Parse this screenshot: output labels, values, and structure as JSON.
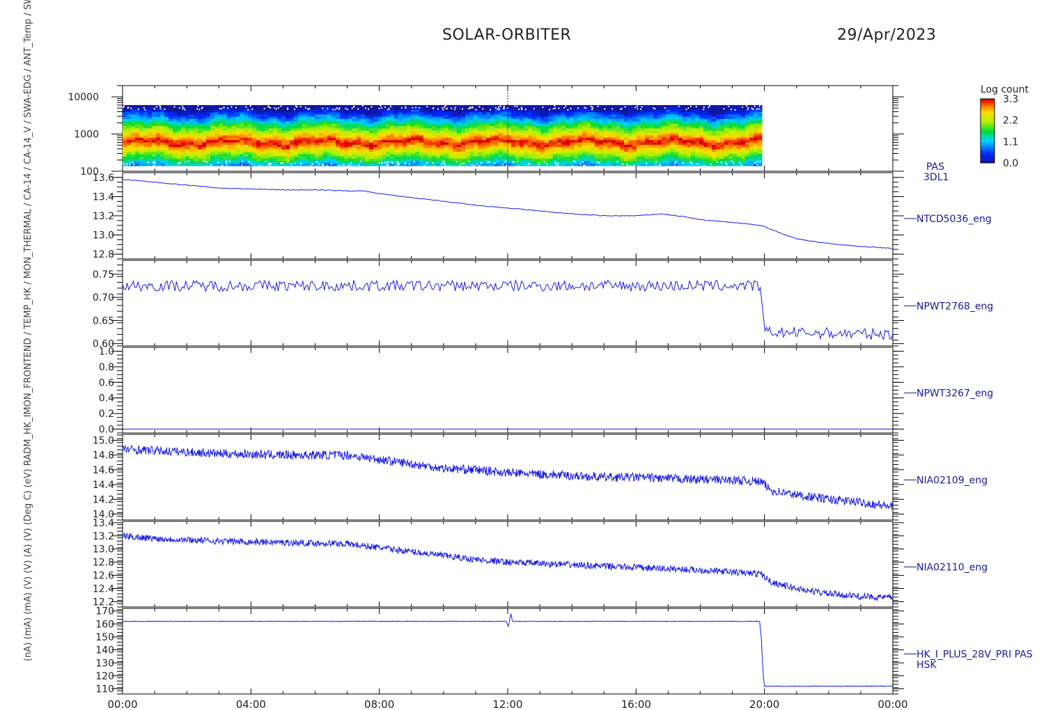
{
  "header": {
    "title": "SOLAR-ORBITER",
    "date": "29/Apr/2023"
  },
  "colors": {
    "trace": "#1a1ae6",
    "label": "#1a1a9a",
    "frame": "#000000"
  },
  "y_axis_stack_label": "(nA) (mA) (mA) (V) (V) (A) (V) (Deg C) (eV) RADM_HK_IMON_FRONTEND / TEMP_HK / MON_THERMAL / CA-14 / CA-14_V / SWA-EDG / ANT_Temp / SWA_EAS_Temp / Flux Temp (DegC) / E",
  "x_axis": {
    "ticks": [
      "00:00",
      "04:00",
      "08:00",
      "12:00",
      "16:00",
      "20:00",
      "00:00"
    ],
    "range_hours": [
      0,
      24
    ]
  },
  "colorbar": {
    "title": "Log count",
    "ticks": [
      "3.3",
      "2.2",
      "1.1",
      "0.0"
    ],
    "range": [
      0.0,
      3.3
    ]
  },
  "chart_data": [
    {
      "type": "heatmap",
      "panel": "PAS 3DL1",
      "right_label_1": "PAS",
      "right_label_2": "3DL1",
      "yscale": "log",
      "ylim": [
        100,
        20000
      ],
      "yticks": [
        "10000",
        "1000",
        "100"
      ],
      "data_end_hour": 19.85,
      "band_peak_energy_eV": 600,
      "band_low_eV": 140,
      "band_high_eV": 6000,
      "disturbance_hours": [
        10.8,
        12.0
      ]
    },
    {
      "type": "line",
      "name": "NTCD5036_eng",
      "ylim": [
        12.75,
        13.65
      ],
      "yticks": [
        "13.6",
        "13.4",
        "13.2",
        "13.0",
        "12.8"
      ],
      "x": [
        0,
        1,
        2,
        3,
        4,
        5,
        6,
        7,
        7.5,
        8,
        9,
        10,
        11,
        12,
        13,
        14,
        15,
        16,
        16.8,
        17.5,
        18,
        19,
        19.9,
        20.5,
        21,
        22,
        23,
        24
      ],
      "values": [
        13.58,
        13.55,
        13.52,
        13.49,
        13.48,
        13.47,
        13.47,
        13.46,
        13.46,
        13.43,
        13.39,
        13.35,
        13.31,
        13.28,
        13.25,
        13.22,
        13.2,
        13.2,
        13.22,
        13.19,
        13.16,
        13.13,
        13.1,
        13.02,
        12.96,
        12.91,
        12.88,
        12.86
      ],
      "noise": 0.004
    },
    {
      "type": "line",
      "name": "NPWT2768_eng",
      "ylim": [
        0.595,
        0.78
      ],
      "yticks": [
        "0.75",
        "0.70",
        "0.65",
        "0.60"
      ],
      "x": [
        0,
        19.85,
        19.9,
        20.0,
        24
      ],
      "values": [
        0.725,
        0.725,
        0.7,
        0.625,
        0.62
      ],
      "noise": 0.012
    },
    {
      "type": "line",
      "name": "NPWT3267_eng",
      "ylim": [
        -0.05,
        1.05
      ],
      "yticks": [
        "1.0",
        "0.8",
        "0.6",
        "0.4",
        "0.2",
        "0.0"
      ],
      "x": [
        0,
        24
      ],
      "values": [
        0.0,
        0.0
      ],
      "noise": 0.0
    },
    {
      "type": "line",
      "name": "NIA02109_eng",
      "ylim": [
        13.92,
        15.08
      ],
      "yticks": [
        "15.0",
        "14.8",
        "14.6",
        "14.4",
        "14.2",
        "14.0"
      ],
      "x": [
        0,
        1,
        3,
        5,
        7,
        8,
        9,
        10,
        11,
        12,
        13,
        14,
        15,
        16,
        17,
        18,
        19,
        19.9,
        20.2,
        21,
        22,
        23,
        24
      ],
      "values": [
        14.88,
        14.86,
        14.82,
        14.8,
        14.8,
        14.74,
        14.68,
        14.62,
        14.6,
        14.56,
        14.54,
        14.52,
        14.5,
        14.5,
        14.48,
        14.47,
        14.46,
        14.44,
        14.32,
        14.26,
        14.2,
        14.16,
        14.1
      ],
      "noise": 0.06
    },
    {
      "type": "line",
      "name": "NIA02110_eng",
      "ylim": [
        12.12,
        13.42
      ],
      "yticks": [
        "13.4",
        "13.2",
        "13.0",
        "12.8",
        "12.6",
        "12.4",
        "12.2"
      ],
      "x": [
        0,
        1,
        3,
        5,
        7,
        8,
        9,
        10,
        11,
        12,
        13,
        14,
        15,
        16,
        17,
        18,
        19,
        19.9,
        20.2,
        21,
        22,
        23,
        24
      ],
      "values": [
        13.2,
        13.16,
        13.12,
        13.1,
        13.08,
        13.02,
        12.96,
        12.9,
        12.84,
        12.8,
        12.78,
        12.76,
        12.74,
        12.72,
        12.7,
        12.68,
        12.65,
        12.62,
        12.5,
        12.4,
        12.32,
        12.28,
        12.26
      ],
      "noise": 0.05
    },
    {
      "type": "line",
      "name": "HK_I_PLUS_28V_PRI PAS",
      "name_line2": "HSK",
      "ylim": [
        106,
        172
      ],
      "yticks": [
        "170",
        "160",
        "150",
        "140",
        "130",
        "120",
        "110"
      ],
      "x": [
        0,
        11.95,
        12.02,
        12.1,
        12.15,
        19.85,
        19.9,
        19.95,
        20.0,
        24
      ],
      "values": [
        162,
        162,
        158,
        168,
        162,
        162,
        150,
        125,
        112,
        112
      ],
      "noise": 0.25
    }
  ]
}
